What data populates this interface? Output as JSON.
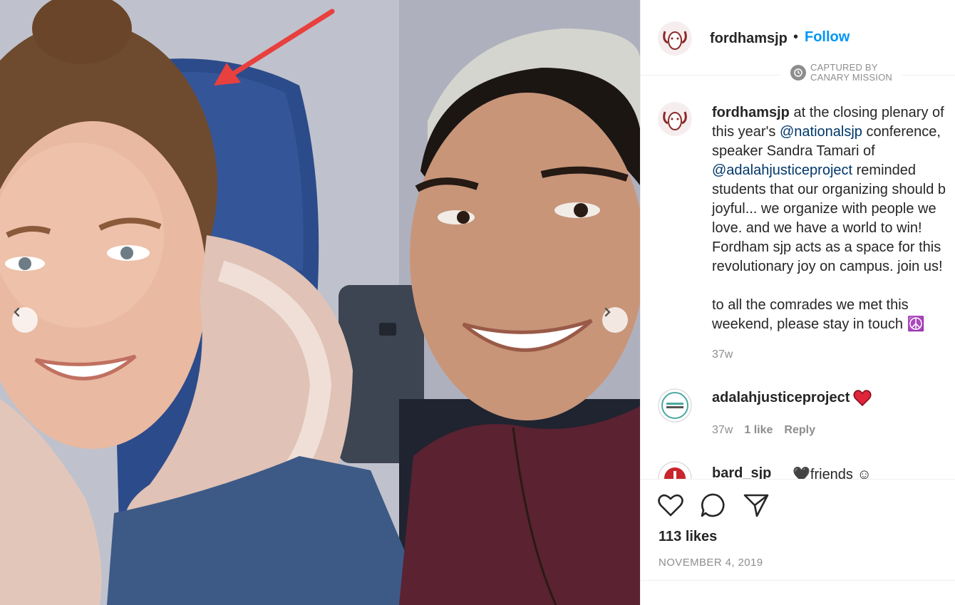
{
  "post": {
    "author": "fordhamsjp",
    "separator": "•",
    "follow_label": "Follow"
  },
  "watermark": {
    "line1": "CAPTURED BY",
    "line2": "CANARY MISSION"
  },
  "caption": {
    "author": "fordhamsjp",
    "part1": " at the closing plenary of this year's ",
    "mention1": "@nationalsjp",
    "part2": " conference, speaker Sandra Tamari of ",
    "mention2": "@adalahjusticeproject",
    "part3": " reminded students that our organizing should b joyful... we organize with people we love. and we have a world to win! Fordham sjp acts as a space for this revolutionary joy on campus. join us!\n\nto all the comrades we met this weekend, please stay in touch ☮️",
    "time": "37w"
  },
  "comments": [
    {
      "user": "adalahjusticeproject",
      "emoji": "heart",
      "time": "37w",
      "likes": "1 like",
      "reply": "Reply"
    },
    {
      "user": "bard_sjp",
      "text": "🖤friends ☺"
    }
  ],
  "actions": {
    "likes": "113 likes",
    "date": "NOVEMBER 4, 2019"
  },
  "icons": [
    "chevron-left-icon",
    "chevron-right-icon",
    "heart-icon",
    "comment-icon",
    "share-icon",
    "clock-icon"
  ],
  "colors": {
    "follow": "#0095f6",
    "mention": "#00376b",
    "heart": "#ed4956",
    "arrow": "#e8403e"
  }
}
